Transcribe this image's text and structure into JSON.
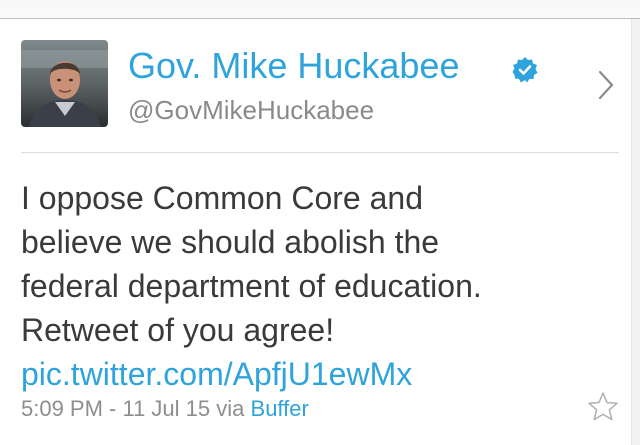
{
  "tweet": {
    "author": {
      "display_name": "Gov. Mike Huckabee",
      "handle": "@GovMikeHuckabee",
      "verified": true,
      "verified_icon": "verified-badge-icon",
      "avatar_description": "profile-photo"
    },
    "text_lines": [
      "I oppose Common Core and",
      "believe we should abolish the",
      "federal department of education.",
      "Retweet of you agree!"
    ],
    "link": "pic.twitter.com/ApfjU1ewMx",
    "timestamp": "5:09 PM - 11 Jul 15",
    "via_label": "via",
    "source": "Buffer"
  },
  "icons": {
    "chevron": "chevron-right-icon",
    "favorite": "star-icon"
  },
  "colors": {
    "link_blue": "#2ea3dc",
    "text": "#3a3a3a",
    "muted": "#8e8e8e"
  }
}
